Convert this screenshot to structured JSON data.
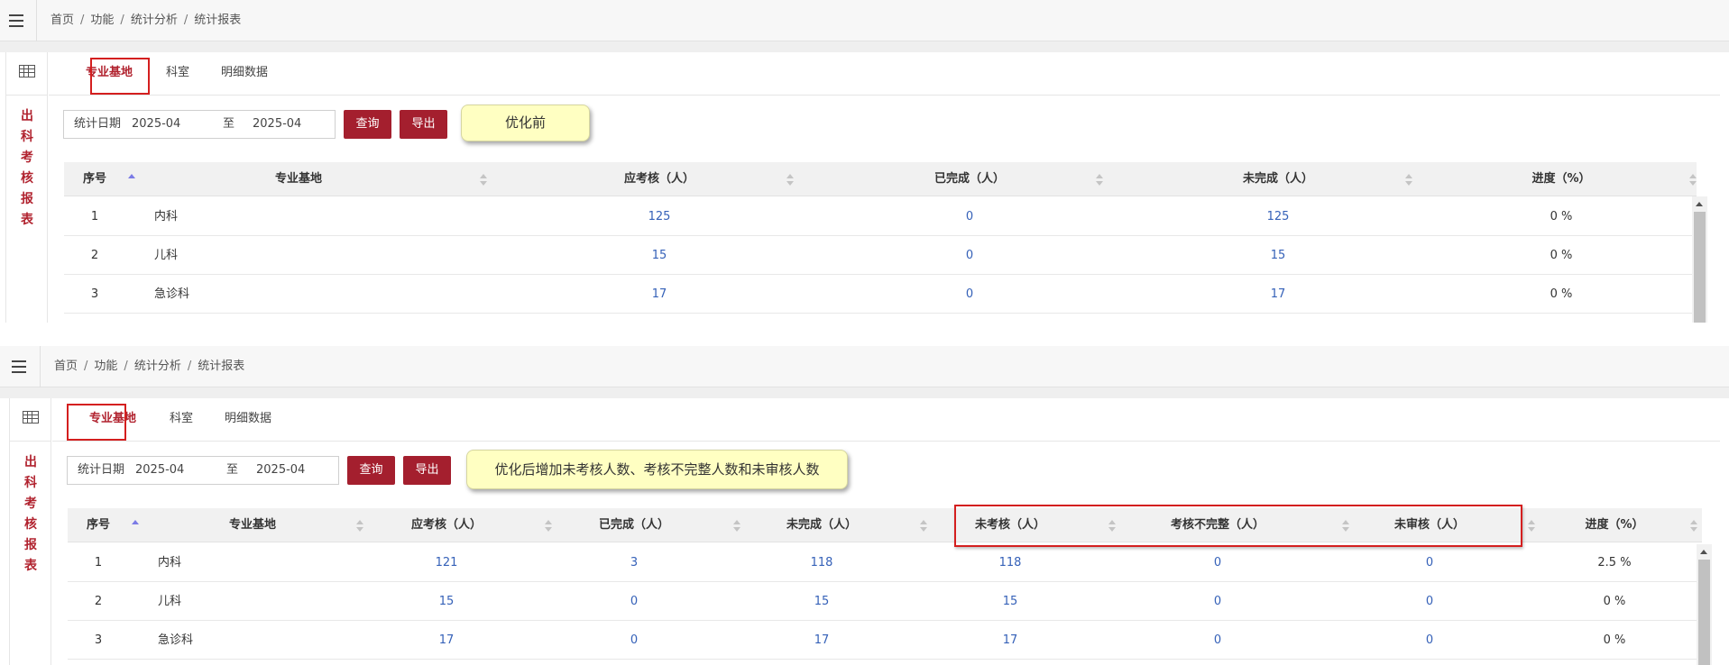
{
  "before": {
    "breadcrumb": [
      "首页",
      "功能",
      "统计分析",
      "统计报表"
    ],
    "vertical_title": [
      "出",
      "科",
      "考",
      "核",
      "报",
      "表"
    ],
    "tabs": [
      "专业基地",
      "科室",
      "明细数据"
    ],
    "filter": {
      "label": "统计日期",
      "from": "2025-04",
      "to_label": "至",
      "to": "2025-04"
    },
    "buttons": {
      "query": "查询",
      "export": "导出"
    },
    "tooltip": "优化前",
    "columns": [
      "序号",
      "专业基地",
      "应考核（人）",
      "已完成（人）",
      "未完成（人）",
      "进度（%）"
    ],
    "rows": [
      [
        "1",
        "内科",
        "125",
        "0",
        "125",
        "0 %"
      ],
      [
        "2",
        "儿科",
        "15",
        "0",
        "15",
        "0 %"
      ],
      [
        "3",
        "急诊科",
        "17",
        "0",
        "17",
        "0 %"
      ]
    ]
  },
  "after": {
    "breadcrumb": [
      "首页",
      "功能",
      "统计分析",
      "统计报表"
    ],
    "vertical_title": [
      "出",
      "科",
      "考",
      "核",
      "报",
      "表"
    ],
    "tabs": [
      "专业基地",
      "科室",
      "明细数据"
    ],
    "filter": {
      "label": "统计日期",
      "from": "2025-04",
      "to_label": "至",
      "to": "2025-04"
    },
    "buttons": {
      "query": "查询",
      "export": "导出"
    },
    "tooltip": "优化后增加未考核人数、考核不完整人数和未审核人数",
    "columns": [
      "序号",
      "专业基地",
      "应考核（人）",
      "已完成（人）",
      "未完成（人）",
      "未考核（人）",
      "考核不完整（人）",
      "未审核（人）",
      "进度（%）"
    ],
    "rows": [
      [
        "1",
        "内科",
        "121",
        "3",
        "118",
        "118",
        "0",
        "0",
        "2.5 %"
      ],
      [
        "2",
        "儿科",
        "15",
        "0",
        "15",
        "15",
        "0",
        "0",
        "0 %"
      ],
      [
        "3",
        "急诊科",
        "17",
        "0",
        "17",
        "17",
        "0",
        "0",
        "0 %"
      ]
    ]
  },
  "colors": {
    "brand": "#a41f2e",
    "highlight": "#d41f1f",
    "link": "#3561b8",
    "tooltip_bg": "#ffffc2"
  },
  "icons": {
    "menu": "hamburger-menu-icon",
    "table": "table-grid-icon",
    "sort": "sort-arrows-icon"
  }
}
